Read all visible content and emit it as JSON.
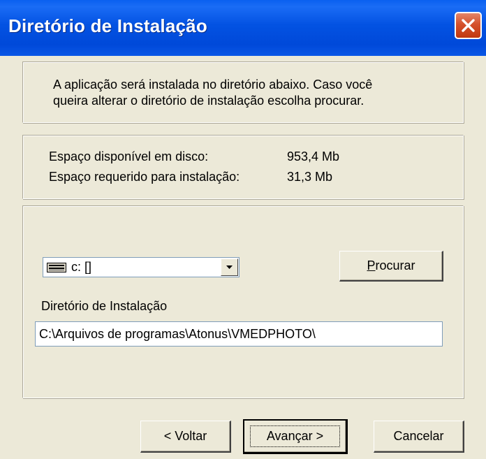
{
  "window": {
    "title": "Diretório de Instalação",
    "close_icon": "close-icon"
  },
  "info": {
    "line1": "A aplicação será instalada no diretório abaixo. Caso você",
    "line2": "queira alterar o diretório de instalação escolha procurar."
  },
  "disk": {
    "available_label": "Espaço disponível  em disco:",
    "available_value": "953,4 Mb",
    "required_label": "Espaço requerido para instalação:",
    "required_value": "31,3 Mb"
  },
  "drive": {
    "selected": "c: []",
    "icon": "drive-icon"
  },
  "buttons": {
    "procurar_first": "P",
    "procurar_rest": "rocurar",
    "voltar": "< Voltar",
    "avancar": "Avançar >",
    "cancelar": "Cancelar"
  },
  "install_dir": {
    "label": "Diretório de Instalação",
    "value": "C:\\Arquivos de programas\\Atonus\\VMEDPHOTO\\"
  },
  "colors": {
    "titlebar": "#0352e2",
    "dialog_bg": "#ece9d8",
    "close_button": "#d5512c"
  }
}
